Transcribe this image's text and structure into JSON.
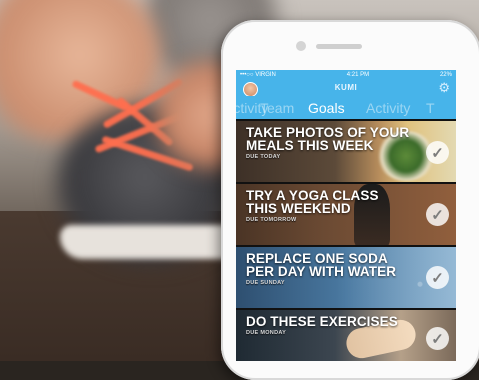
{
  "status_bar": {
    "carrier": "•••○○ VIRGIN",
    "time": "4:21 PM",
    "battery": "22%"
  },
  "app": {
    "title": "KUMI",
    "settings_icon": "gear-icon",
    "avatar_icon": "user-avatar"
  },
  "tabs": [
    {
      "label": "Activity",
      "active": false
    },
    {
      "label": "Team",
      "active": false
    },
    {
      "label": "Goals",
      "active": true
    },
    {
      "label": "Activity",
      "active": false
    },
    {
      "label": "T",
      "active": false
    }
  ],
  "goals": [
    {
      "title": "TAKE PHOTOS OF YOUR MEALS THIS WEEK",
      "due": "DUE TODAY",
      "check_icon": "checkmark-icon"
    },
    {
      "title": "TRY A YOGA CLASS THIS WEEKEND",
      "due": "DUE TOMORROW",
      "check_icon": "checkmark-icon"
    },
    {
      "title": "REPLACE ONE SODA PER DAY WITH WATER",
      "due": "DUE SUNDAY",
      "check_icon": "checkmark-icon"
    },
    {
      "title": "DO THESE EXERCISES",
      "due": "DUE MONDAY",
      "check_icon": "checkmark-icon"
    }
  ],
  "colors": {
    "accent": "#47b4ea",
    "lace": "#ff6f4f"
  }
}
